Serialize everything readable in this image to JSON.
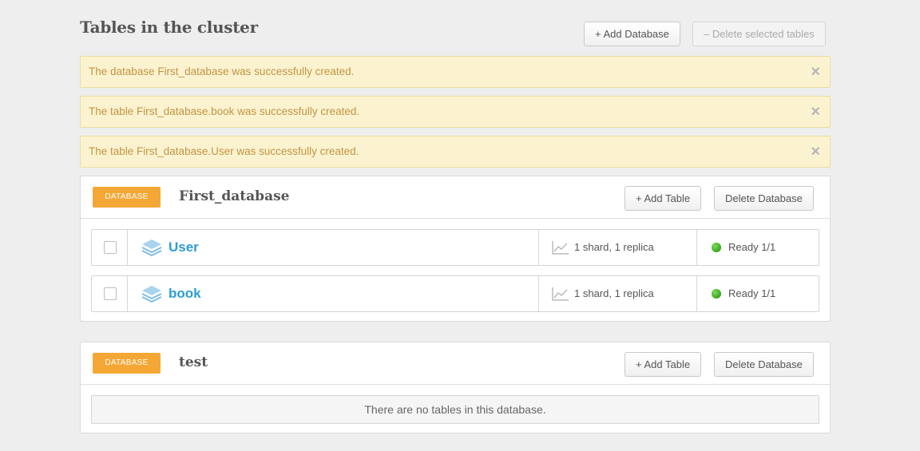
{
  "page": {
    "title": "Tables in the cluster",
    "add_database_label": "+ Add Database",
    "delete_tables_label": "– Delete selected tables"
  },
  "alerts": [
    {
      "text": "The database First_database was successfully created.",
      "close": "×"
    },
    {
      "text": "The table First_database.book was successfully created.",
      "close": "×"
    },
    {
      "text": "The table First_database.User was successfully created.",
      "close": "×"
    }
  ],
  "databases": [
    {
      "badge": "DATABASE",
      "name": "First_database",
      "add_table_label": "+ Add Table",
      "delete_label": "Delete Database",
      "tables": [
        {
          "name": "User",
          "shards": "1 shard, 1 replica",
          "status": "Ready 1/1",
          "status_color": "#4cbb2b"
        },
        {
          "name": "book",
          "shards": "1 shard, 1 replica",
          "status": "Ready 1/1",
          "status_color": "#4cbb2b"
        }
      ]
    },
    {
      "badge": "DATABASE",
      "name": "test",
      "add_table_label": "+ Add Table",
      "delete_label": "Delete Database",
      "empty_message": "There are no tables in this database."
    }
  ],
  "icons": {
    "table": "layers-icon",
    "shards": "line-chart-icon",
    "status": "status-dot-icon",
    "close": "close-icon"
  },
  "colors": {
    "badge": "#f4a735",
    "link": "#2b9ed3",
    "alert_bg": "#fbf2cf",
    "alert_text": "#c29545"
  }
}
